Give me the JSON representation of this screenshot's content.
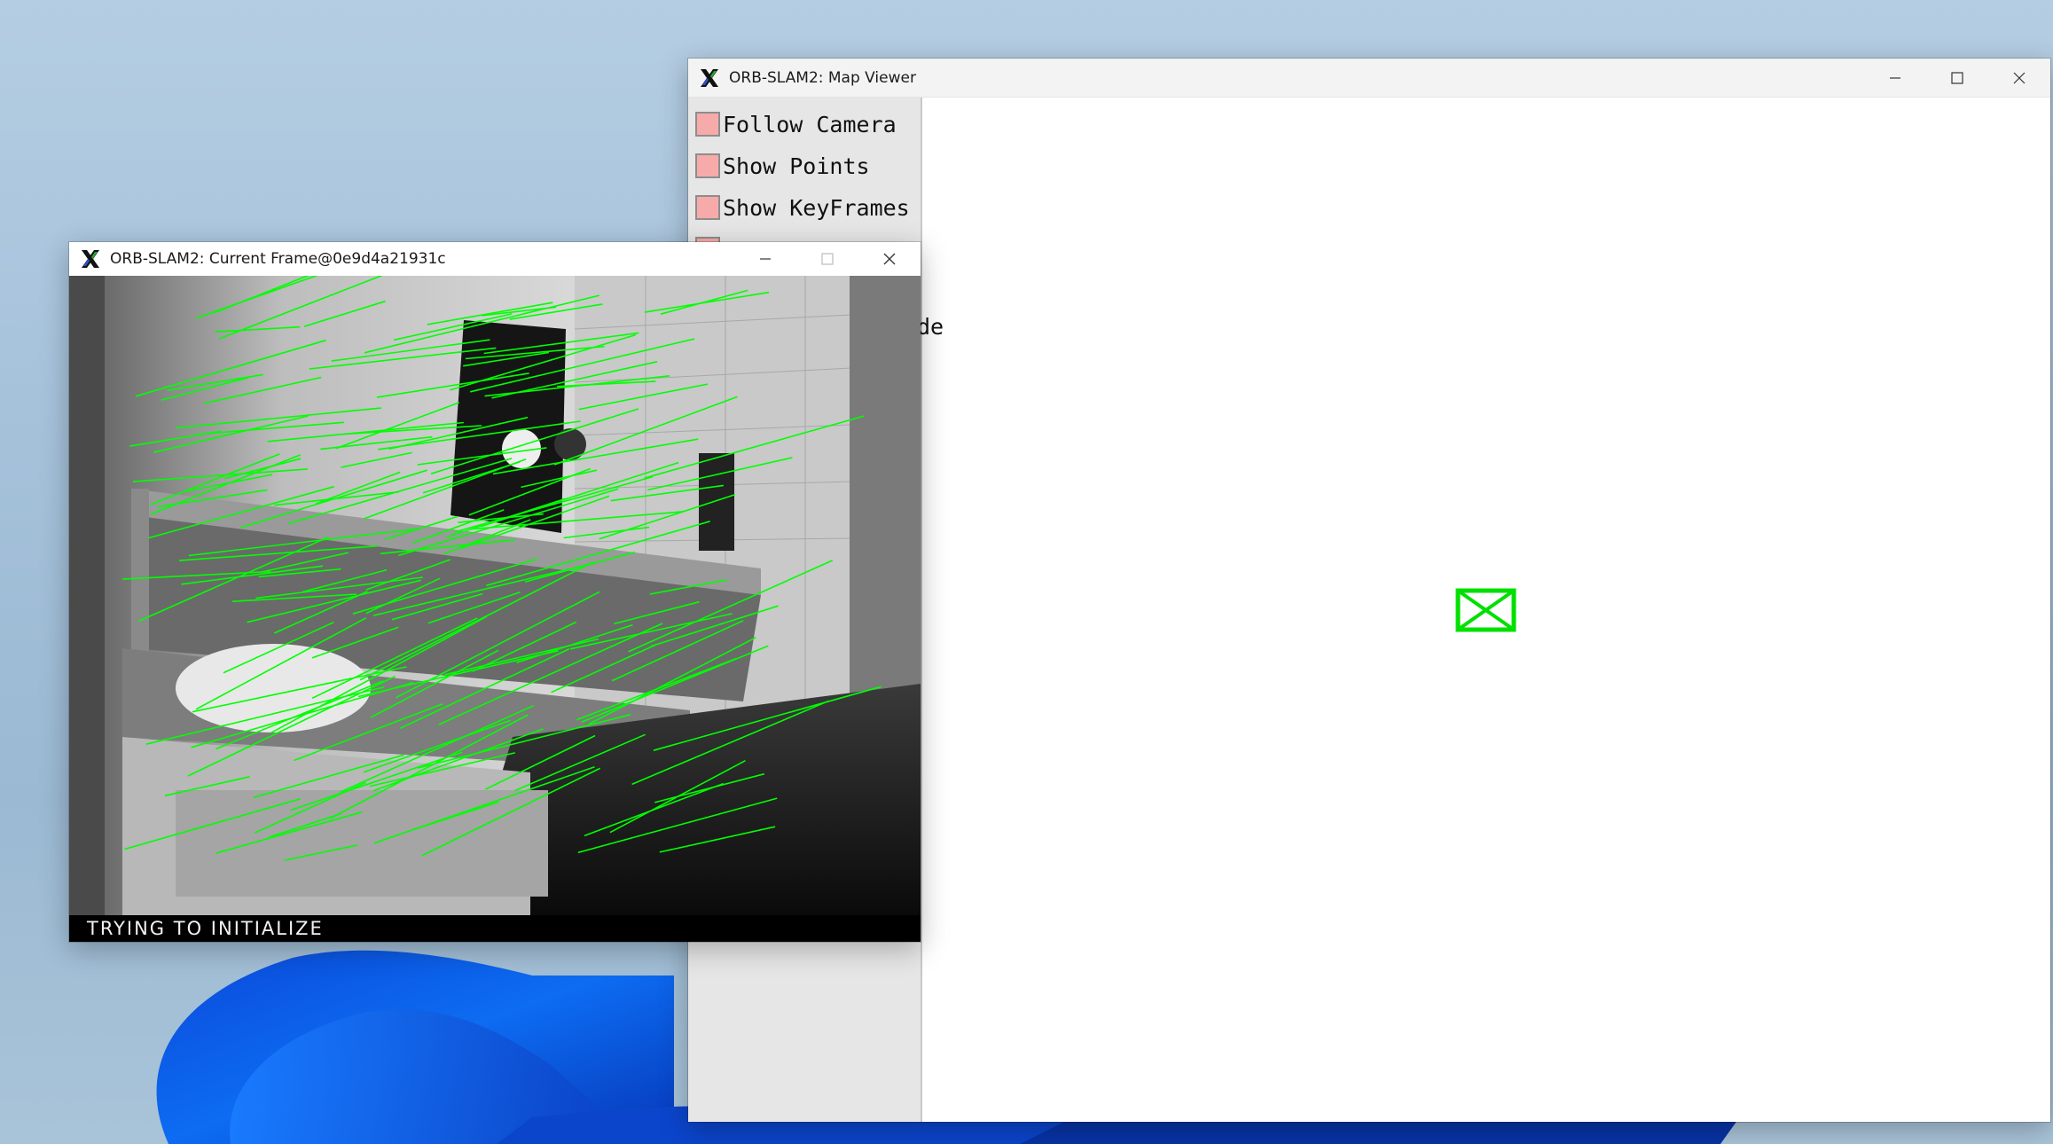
{
  "map_viewer": {
    "title": "ORB-SLAM2: Map Viewer",
    "panel_items": [
      {
        "label": "Follow Camera"
      },
      {
        "label": "Show Points"
      },
      {
        "label": "Show KeyFrames"
      }
    ],
    "partial_text": "de",
    "camera_color": "#00ff00"
  },
  "current_frame": {
    "title": "ORB-SLAM2: Current Frame@0e9d4a21931c",
    "status": "TRYING TO INITIALIZE",
    "match_color": "#00ff00"
  }
}
